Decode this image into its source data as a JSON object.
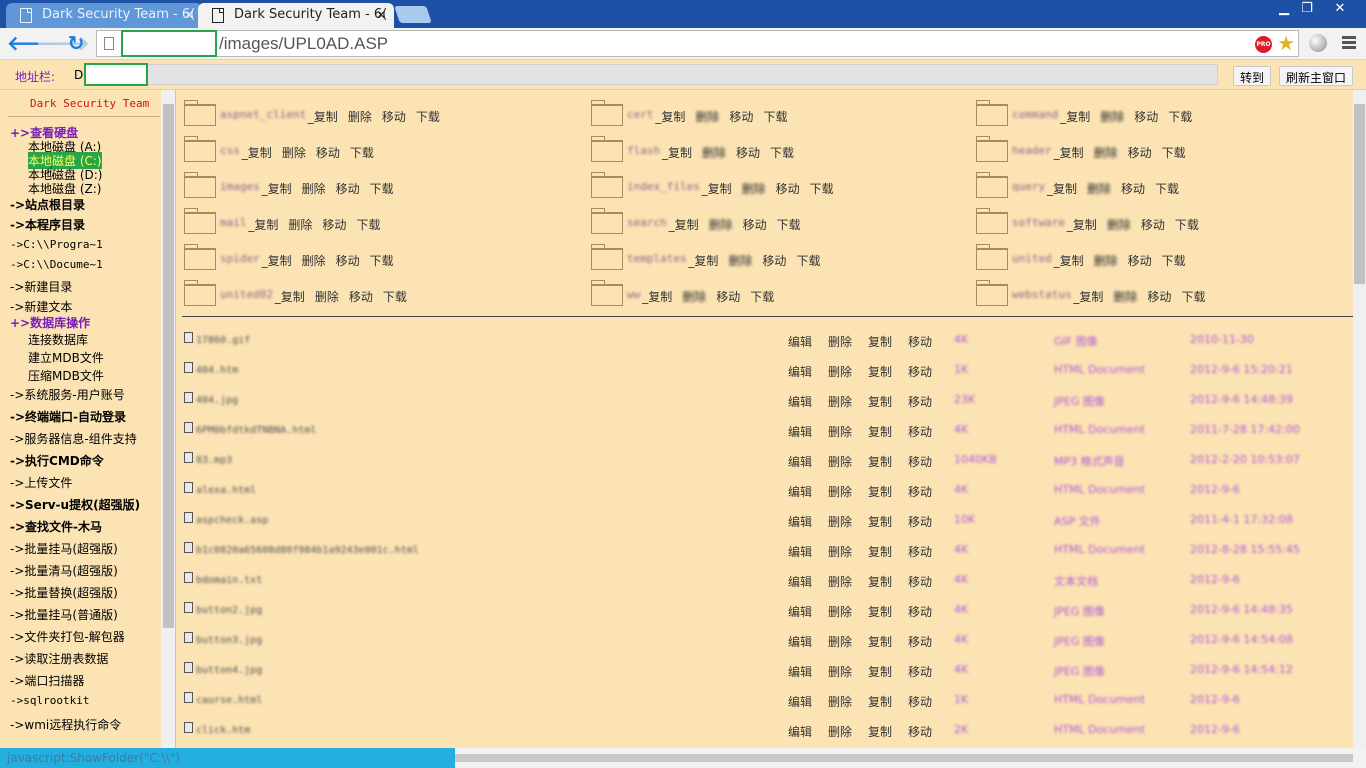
{
  "browser": {
    "tabs": [
      {
        "label": "Dark Security Team - 6(",
        "active": false
      },
      {
        "label": "Dark Security Team - 6(",
        "active": true
      }
    ],
    "address": {
      "path": "/images/UPL0AD.ASP"
    },
    "window_controls": {
      "minimize": "▁",
      "maximize": "❐",
      "close": "✕"
    },
    "pro_badge": "PRO"
  },
  "addrbar": {
    "label": "地址栏:",
    "drive_prefix": "D",
    "go_button": "转到",
    "refresh_button": "刷新主窗口"
  },
  "sidebar": {
    "title": "Dark Security Team",
    "items": [
      {
        "label": "+>查看硬盘",
        "style": "purple"
      },
      {
        "label": "本地磁盘 (A:)",
        "style": "sub"
      },
      {
        "label": "本地磁盘 (C:)",
        "style": "sub-selected"
      },
      {
        "label": "本地磁盘 (D:)",
        "style": "sub"
      },
      {
        "label": "本地磁盘 (Z:)",
        "style": "sub"
      },
      {
        "label": "->站点根目录",
        "style": "bold"
      },
      {
        "label": "->本程序目录",
        "style": "bold"
      },
      {
        "label": "->C:\\\\Progra~1",
        "style": "mono"
      },
      {
        "label": "->C:\\\\Docume~1",
        "style": "mono"
      },
      {
        "label": "->新建目录",
        "style": "normal"
      },
      {
        "label": "->新建文本",
        "style": "normal"
      },
      {
        "label": "+>数据库操作",
        "style": "purple"
      },
      {
        "label": "连接数据库",
        "style": "sub"
      },
      {
        "label": "建立MDB文件",
        "style": "sub"
      },
      {
        "label": "压缩MDB文件",
        "style": "sub"
      },
      {
        "label": "->系统服务-用户账号",
        "style": "normal"
      },
      {
        "label": "->终端端口-自动登录",
        "style": "bold"
      },
      {
        "label": "->服务器信息-组件支持",
        "style": "normal"
      },
      {
        "label": "->执行CMD命令",
        "style": "bold"
      },
      {
        "label": "->上传文件",
        "style": "normal"
      },
      {
        "label": "->Serv-u提权(超强版)",
        "style": "bold"
      },
      {
        "label": "->查找文件-木马",
        "style": "bold"
      },
      {
        "label": "->批量挂马(超强版)",
        "style": "normal"
      },
      {
        "label": "->批量清马(超强版)",
        "style": "normal"
      },
      {
        "label": "->批量替换(超强版)",
        "style": "normal"
      },
      {
        "label": "->批量挂马(普通版)",
        "style": "normal"
      },
      {
        "label": "->文件夹打包-解包器",
        "style": "normal"
      },
      {
        "label": "->读取注册表数据",
        "style": "normal"
      },
      {
        "label": "->端口扫描器",
        "style": "normal"
      },
      {
        "label": "->sqlrootkit",
        "style": "mono"
      },
      {
        "label": "->wmi远程执行命令",
        "style": "normal"
      }
    ]
  },
  "folder_actions": [
    "_复制",
    "删除",
    "移动",
    "下载"
  ],
  "folders": [
    {
      "name": "aspnet_client"
    },
    {
      "name": "cert"
    },
    {
      "name": "command"
    },
    {
      "name": "css"
    },
    {
      "name": "flash"
    },
    {
      "name": "header"
    },
    {
      "name": "images"
    },
    {
      "name": "index_files"
    },
    {
      "name": "query"
    },
    {
      "name": "mail"
    },
    {
      "name": "search"
    },
    {
      "name": "software"
    },
    {
      "name": "spider"
    },
    {
      "name": "templates"
    },
    {
      "name": "united"
    },
    {
      "name": "united02"
    },
    {
      "name": "ww"
    },
    {
      "name": "webstatus"
    }
  ],
  "file_actions": [
    "编辑",
    "删除",
    "复制",
    "移动"
  ],
  "files": [
    {
      "name": "17860.gif",
      "size": "4K",
      "type": "GIF 图像",
      "date": "2010-11-30"
    },
    {
      "name": "404.htm",
      "size": "1K",
      "type": "HTML Document",
      "date": "2012-9-6 15:20:21"
    },
    {
      "name": "404.jpg",
      "size": "23K",
      "type": "JPEG 图像",
      "date": "2012-9-6 14:48:39"
    },
    {
      "name": "6PM0bfdtkdTNBNA.html",
      "size": "4K",
      "type": "HTML Document",
      "date": "2011-7-28 17:42:00"
    },
    {
      "name": "83.mp3",
      "size": "1040KB",
      "type": "MP3 格式声音",
      "date": "2012-2-20 10:53:07"
    },
    {
      "name": "alexa.html",
      "size": "4K",
      "type": "HTML Document",
      "date": "2012-9-6"
    },
    {
      "name": "aspcheck.asp",
      "size": "10K",
      "type": "ASP 文件",
      "date": "2011-4-1 17:32:08"
    },
    {
      "name": "b1c0820a65608d80f984b1a9243e001c.html",
      "size": "4K",
      "type": "HTML Document",
      "date": "2012-8-28 15:55:45"
    },
    {
      "name": "bdomain.txt",
      "size": "4K",
      "type": "文本文档",
      "date": "2012-9-6"
    },
    {
      "name": "button2.jpg",
      "size": "4K",
      "type": "JPEG 图像",
      "date": "2012-9-6 14:48:35"
    },
    {
      "name": "button3.jpg",
      "size": "4K",
      "type": "JPEG 图像",
      "date": "2012-9-6 14:54:08"
    },
    {
      "name": "button4.jpg",
      "size": "4K",
      "type": "JPEG 图像",
      "date": "2012-9-6 14:54:12"
    },
    {
      "name": "caurse.html",
      "size": "1K",
      "type": "HTML Document",
      "date": "2012-9-6"
    },
    {
      "name": "click.htm",
      "size": "2K",
      "type": "HTML Document",
      "date": "2012-9-6"
    }
  ],
  "status": {
    "text": "javascript:ShowFolder(\"C:\\\\\")"
  },
  "colors": {
    "page_bg": "#fbe3b4",
    "accent_purple": "#7a1fb8",
    "title_red": "#cc1515",
    "select_green": "#2aa44a"
  }
}
